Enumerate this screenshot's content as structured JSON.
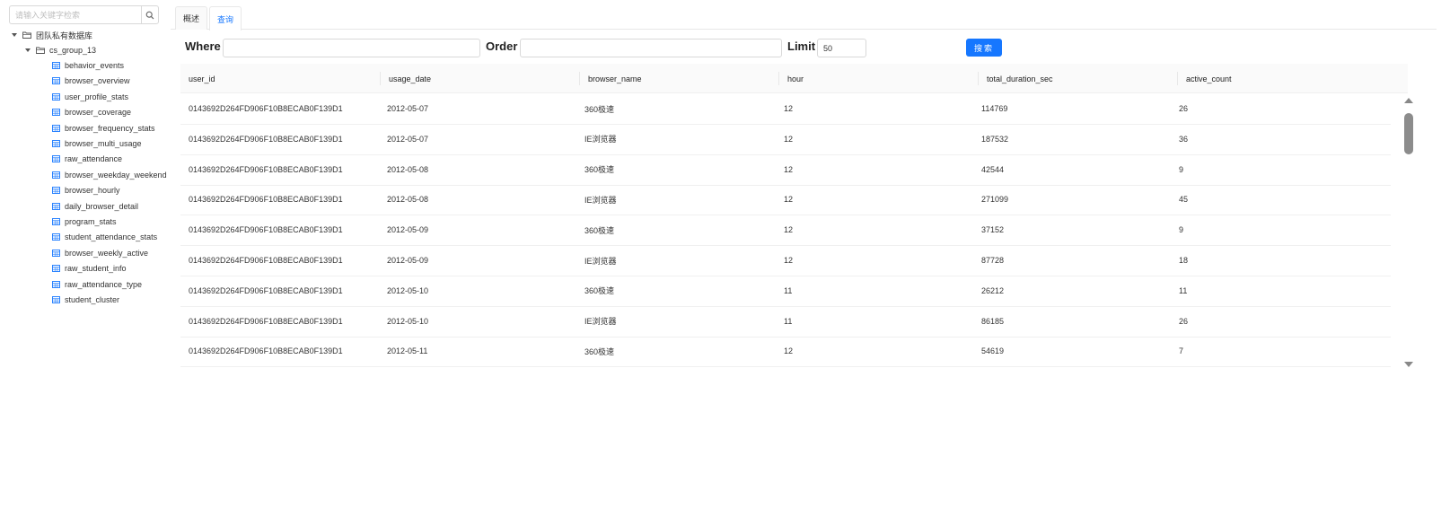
{
  "sidebar": {
    "search_placeholder": "请输入关键字检索",
    "root": {
      "label": "团队私有数据库"
    },
    "group": {
      "label": "cs_group_13"
    },
    "tables": [
      "behavior_events",
      "browser_overview",
      "user_profile_stats",
      "browser_coverage",
      "browser_frequency_stats",
      "browser_multi_usage",
      "raw_attendance",
      "browser_weekday_weekend",
      "browser_hourly",
      "daily_browser_detail",
      "program_stats",
      "student_attendance_stats",
      "browser_weekly_active",
      "raw_student_info",
      "raw_attendance_type",
      "student_cluster"
    ]
  },
  "tabs": [
    {
      "label": "概述",
      "active": false
    },
    {
      "label": "查询",
      "active": true
    }
  ],
  "filter": {
    "where_label": "Where",
    "where_value": "",
    "order_label": "Order",
    "order_value": "",
    "limit_label": "Limit",
    "limit_value": "50",
    "search_button": "搜索"
  },
  "table": {
    "columns": [
      "user_id",
      "usage_date",
      "browser_name",
      "hour",
      "total_duration_sec",
      "active_count"
    ],
    "rows": [
      [
        "0143692D264FD906F10B8ECAB0F139D1",
        "2012-05-07",
        "360极速",
        "12",
        "114769",
        "26"
      ],
      [
        "0143692D264FD906F10B8ECAB0F139D1",
        "2012-05-07",
        "IE浏览器",
        "12",
        "187532",
        "36"
      ],
      [
        "0143692D264FD906F10B8ECAB0F139D1",
        "2012-05-08",
        "360极速",
        "12",
        "42544",
        "9"
      ],
      [
        "0143692D264FD906F10B8ECAB0F139D1",
        "2012-05-08",
        "IE浏览器",
        "12",
        "271099",
        "45"
      ],
      [
        "0143692D264FD906F10B8ECAB0F139D1",
        "2012-05-09",
        "360极速",
        "12",
        "37152",
        "9"
      ],
      [
        "0143692D264FD906F10B8ECAB0F139D1",
        "2012-05-09",
        "IE浏览器",
        "12",
        "87728",
        "18"
      ],
      [
        "0143692D264FD906F10B8ECAB0F139D1",
        "2012-05-10",
        "360极速",
        "11",
        "26212",
        "11"
      ],
      [
        "0143692D264FD906F10B8ECAB0F139D1",
        "2012-05-10",
        "IE浏览器",
        "11",
        "86185",
        "26"
      ],
      [
        "0143692D264FD906F10B8ECAB0F139D1",
        "2012-05-11",
        "360极速",
        "12",
        "54619",
        "7"
      ]
    ]
  },
  "colors": {
    "accent": "#1677ff",
    "border": "#d9d9d9",
    "header_bg": "#fafafa"
  }
}
